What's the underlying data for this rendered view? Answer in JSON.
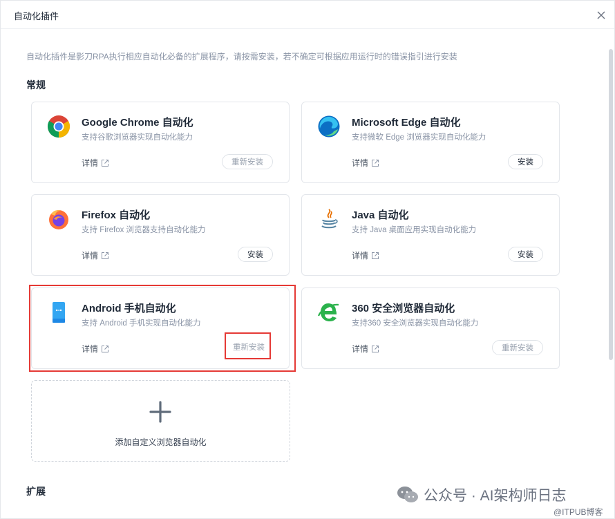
{
  "dialog": {
    "title": "自动化插件",
    "description": "自动化插件是影刀RPA执行相应自动化必备的扩展程序，请按需安装，若不确定可根据应用运行时的错误指引进行安装"
  },
  "sections": {
    "general": "常规",
    "extension": "扩展"
  },
  "cards": [
    {
      "name": "Google Chrome 自动化",
      "desc": "支持谷歌浏览器实现自动化能力",
      "detail": "详情",
      "action": "重新安装",
      "action_type": "reinstall",
      "icon": "chrome-icon"
    },
    {
      "name": "Microsoft Edge 自动化",
      "desc": "支持微软 Edge 浏览器实现自动化能力",
      "detail": "详情",
      "action": "安装",
      "action_type": "install",
      "icon": "edge-icon"
    },
    {
      "name": "Firefox 自动化",
      "desc": "支持 Firefox 浏览器支持自动化能力",
      "detail": "详情",
      "action": "安装",
      "action_type": "install",
      "icon": "firefox-icon"
    },
    {
      "name": "Java 自动化",
      "desc": "支持 Java 桌面应用实现自动化能力",
      "detail": "详情",
      "action": "安装",
      "action_type": "install",
      "icon": "java-icon"
    },
    {
      "name": "Android 手机自动化",
      "desc": "支持 Android 手机实现自动化能力",
      "detail": "详情",
      "action": "重新安装",
      "action_type": "reinstall",
      "icon": "android-phone-icon"
    },
    {
      "name": "360 安全浏览器自动化",
      "desc": "支持360 安全浏览器实现自动化能力",
      "detail": "详情",
      "action": "重新安装",
      "action_type": "reinstall",
      "icon": "360-browser-icon"
    }
  ],
  "add_card": {
    "label": "添加自定义浏览器自动化"
  },
  "watermark": {
    "main": "公众号 · AI架构师日志",
    "sub": "@ITPUB博客"
  },
  "colors": {
    "highlight": "#e53935",
    "muted_text": "#8a94a6",
    "border": "#e3e6eb"
  }
}
